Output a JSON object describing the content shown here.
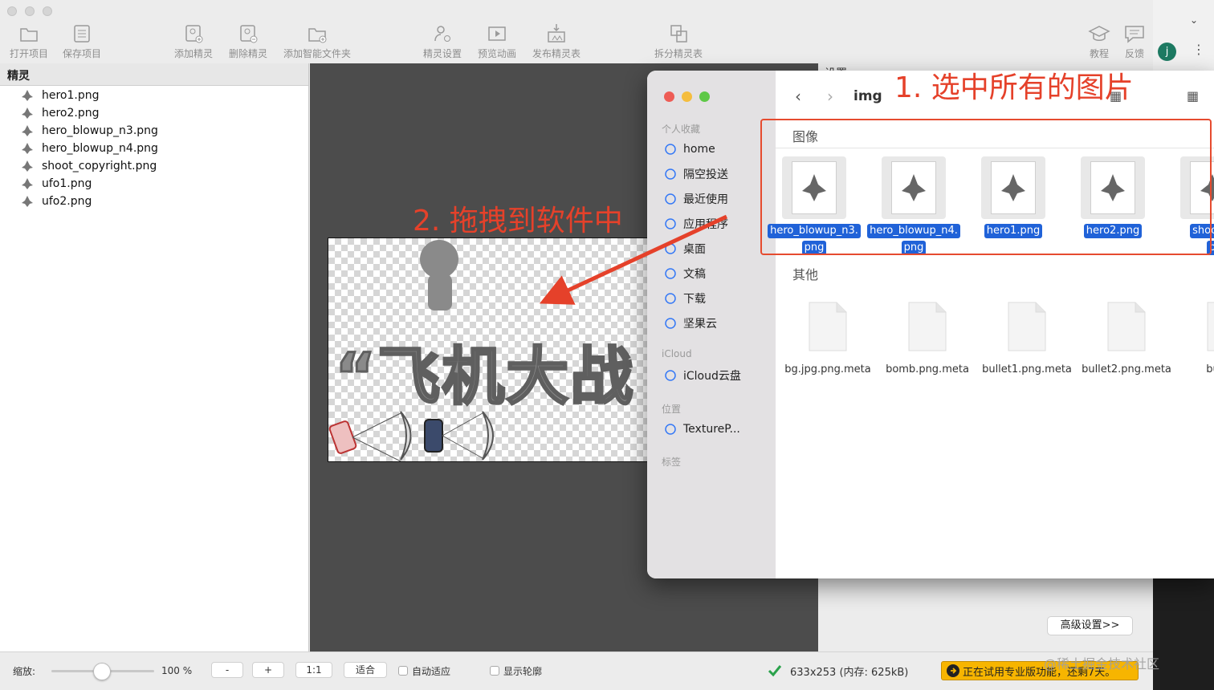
{
  "toolbar": {
    "open_project": "打开项目",
    "save_project": "保存项目",
    "add_sprite": "添加精灵",
    "delete_sprite": "删除精灵",
    "add_smart_folder": "添加智能文件夹",
    "sprite_settings": "精灵设置",
    "preview_animation": "预览动画",
    "publish_sprite_sheet": "发布精灵表",
    "split_sprite_sheet": "拆分精灵表",
    "tutorial": "教程",
    "feedback": "反馈",
    "user_initial": "j"
  },
  "sprite_panel": {
    "title": "精灵",
    "items": [
      "hero1.png",
      "hero2.png",
      "hero_blowup_n3.png",
      "hero_blowup_n4.png",
      "shoot_copyright.png",
      "ufo1.png",
      "ufo2.png"
    ]
  },
  "canvas": {
    "sheet_title_text": "“飞机大战"
  },
  "settings_panel": {
    "title": "设置",
    "advanced_button": "高级设置>>"
  },
  "bottom_bar": {
    "zoom_label": "缩放:",
    "zoom_value": "100 %",
    "zoom_percent": 100,
    "minus": "-",
    "plus": "+",
    "one_to_one": "1:1",
    "fit": "适合",
    "auto_fit": "自动适应",
    "show_outline": "显示轮廓",
    "size_info": "633x253 (内存: 625kB)",
    "pro_trial": "正在试用专业版功能，还剩7天。"
  },
  "finder": {
    "folder_title": "img",
    "sidebar": {
      "favorites_header": "个人收藏",
      "favorites": [
        {
          "label": "home",
          "icon": "house-icon"
        },
        {
          "label": "隔空投送",
          "icon": "airdrop-icon"
        },
        {
          "label": "最近使用",
          "icon": "clock-icon"
        },
        {
          "label": "应用程序",
          "icon": "apps-icon"
        },
        {
          "label": "桌面",
          "icon": "desktop-icon"
        },
        {
          "label": "文稿",
          "icon": "document-icon"
        },
        {
          "label": "下载",
          "icon": "download-icon"
        },
        {
          "label": "坚果云",
          "icon": "folder-icon"
        }
      ],
      "icloud_header": "iCloud",
      "icloud_items": [
        {
          "label": "iCloud云盘",
          "icon": "cloud-icon"
        }
      ],
      "locations_header": "位置",
      "locations": [
        {
          "label": "TextureP...",
          "icon": "disk-icon"
        }
      ],
      "tags_header": "标签"
    },
    "images_section": "图像",
    "images": [
      {
        "line1": "hero_blowup_n3.",
        "line2": "png"
      },
      {
        "line1": "hero_blowup_n4.",
        "line2": "png"
      },
      {
        "line1": "hero1.png",
        "line2": ""
      },
      {
        "line1": "hero2.png",
        "line2": ""
      },
      {
        "line1": "shoot_c",
        "line2": "p"
      }
    ],
    "others_section": "其他",
    "others": [
      {
        "line1": "bg.jpg.png.meta",
        "line2": ""
      },
      {
        "line1": "bomb.png.meta",
        "line2": ""
      },
      {
        "line1": "bullet1.png.meta",
        "line2": ""
      },
      {
        "line1": "bullet2.png.meta",
        "line2": ""
      },
      {
        "line1": "button_",
        "line2": "g"
      }
    ]
  },
  "annotations": {
    "step1": "1. 选中所有的图片",
    "step2": "2. 拖拽到软件中",
    "color": "#e5412a"
  },
  "watermark": "@稀土掘金技术社区"
}
